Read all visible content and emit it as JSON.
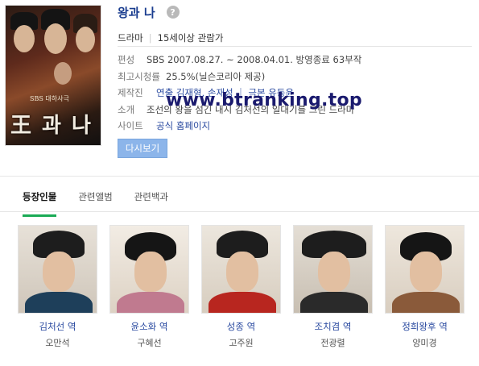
{
  "header": {
    "title": "왕과 나",
    "help_icon": "question-icon",
    "genre": "드라마",
    "rating_age": "15세이상 관람가"
  },
  "poster": {
    "sbs_text": "SBS 대하사극",
    "title_art": "王 과 나"
  },
  "info": {
    "rows": [
      {
        "label": "편성",
        "value": "SBS 2007.08.27. ~ 2008.04.01. 방영종료 63부작"
      },
      {
        "label": "최고시청률",
        "value_rating": "25.5%",
        "value_rest": " (닐슨코리아 제공)"
      },
      {
        "label": "제작진",
        "value": "연출 김재형, 손재성 ｜ 극본 유동윤"
      },
      {
        "label": "소개",
        "value": "조선의 왕을 섬긴 내시 김처선의 일대기를 그린 드라마"
      },
      {
        "label": "사이트",
        "value": "공식 홈페이지"
      }
    ],
    "rewatch_button": "다시보기"
  },
  "watermark": "www.btranking.top",
  "tabs": [
    "등장인물",
    "관련앨범",
    "관련백과"
  ],
  "cast": [
    {
      "role": "김처선 역",
      "actor": "오만석"
    },
    {
      "role": "윤소화 역",
      "actor": "구혜선"
    },
    {
      "role": "성종 역",
      "actor": "고주원"
    },
    {
      "role": "조치겸 역",
      "actor": "전광렬"
    },
    {
      "role": "정희왕후 역",
      "actor": "양미경"
    }
  ],
  "colors": {
    "title": "#1a3d8f",
    "link": "#2a4aa0",
    "rating": "#d23a2a",
    "tab_active_underline": "#1aaa55",
    "button_bg": "#8cb5ea"
  }
}
